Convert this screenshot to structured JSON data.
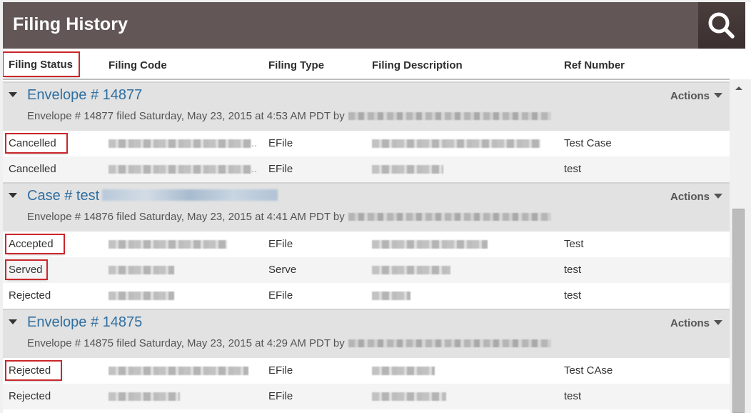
{
  "header": {
    "title": "Filing History",
    "search_icon": "search-icon"
  },
  "columns": [
    "Filing Status",
    "Filing Code",
    "Filing Type",
    "Filing Description",
    "Ref Number"
  ],
  "groups": [
    {
      "title": "Envelope # 14877",
      "title_redacted": false,
      "subtitle": "Envelope # 14877 filed Saturday, May 23, 2015 at 4:53 AM PDT by",
      "actions_label": "Actions",
      "rows": [
        {
          "status": "Cancelled",
          "highlighted": true,
          "code_redacted": true,
          "code_suffix": "..",
          "type": "EFile",
          "description_redacted": true,
          "ref": "Test Case"
        },
        {
          "status": "Cancelled",
          "highlighted": false,
          "code_redacted": true,
          "code_suffix": "..",
          "type": "EFile",
          "description_redacted": true,
          "ref": "test"
        }
      ]
    },
    {
      "title": "Case # test",
      "title_redacted": true,
      "subtitle": "Envelope # 14876 filed Saturday, May 23, 2015 at 4:41 AM PDT by",
      "actions_label": "Actions",
      "rows": [
        {
          "status": "Accepted",
          "highlighted": true,
          "code_redacted": true,
          "type": "EFile",
          "description_redacted": true,
          "ref": "Test"
        },
        {
          "status": "Served",
          "highlighted": true,
          "code_redacted": true,
          "type": "Serve",
          "description_redacted": true,
          "ref": "test"
        },
        {
          "status": "Rejected",
          "highlighted": false,
          "code_redacted": true,
          "type": "EFile",
          "description_redacted": true,
          "ref": "test"
        }
      ]
    },
    {
      "title": "Envelope # 14875",
      "title_redacted": false,
      "subtitle": "Envelope # 14875 filed Saturday, May 23, 2015 at 4:29 AM PDT by",
      "actions_label": "Actions",
      "rows": [
        {
          "status": "Rejected",
          "highlighted": true,
          "code_redacted": true,
          "type": "EFile",
          "description_redacted": true,
          "ref": "Test CAse"
        },
        {
          "status": "Rejected",
          "highlighted": false,
          "code_redacted": true,
          "type": "EFile",
          "description_redacted": true,
          "ref": "test"
        }
      ]
    }
  ],
  "colors": {
    "titlebar": "#625656",
    "link": "#2f6fa1",
    "highlight": "#c9272b",
    "group_bg": "#e2e2e2"
  }
}
